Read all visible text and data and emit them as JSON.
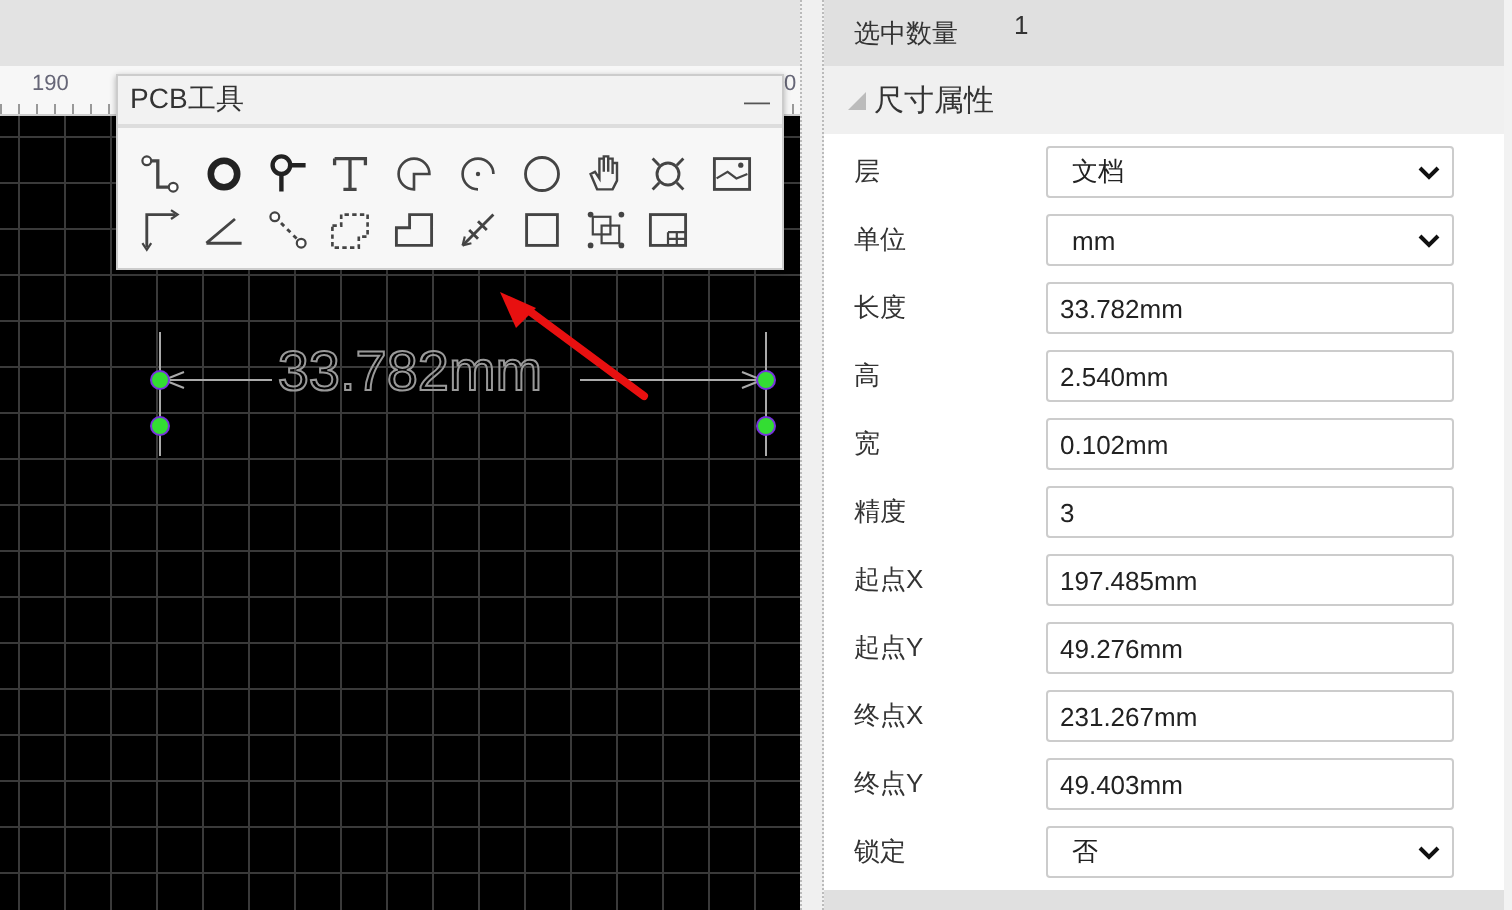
{
  "ruler": {
    "labels": [
      "190",
      "0"
    ]
  },
  "pcb_tools": {
    "title": "PCB工具",
    "minimize": "—"
  },
  "canvas": {
    "dimension_label": "33.782mm"
  },
  "selection": {
    "label": "选中数量",
    "count": "1"
  },
  "section": {
    "title": "尺寸属性",
    "expanded": true
  },
  "properties": [
    {
      "label": "层",
      "value": "文档",
      "kind": "select"
    },
    {
      "label": "单位",
      "value": "mm",
      "kind": "select"
    },
    {
      "label": "长度",
      "value": "33.782mm",
      "kind": "text"
    },
    {
      "label": "高",
      "value": "2.540mm",
      "kind": "text"
    },
    {
      "label": "宽",
      "value": "0.102mm",
      "kind": "text"
    },
    {
      "label": "精度",
      "value": "3",
      "kind": "text"
    },
    {
      "label": "起点X",
      "value": "197.485mm",
      "kind": "text"
    },
    {
      "label": "起点Y",
      "value": "49.276mm",
      "kind": "text"
    },
    {
      "label": "终点X",
      "value": "231.267mm",
      "kind": "text"
    },
    {
      "label": "终点Y",
      "value": "49.403mm",
      "kind": "text"
    },
    {
      "label": "锁定",
      "value": "否",
      "kind": "select"
    }
  ]
}
